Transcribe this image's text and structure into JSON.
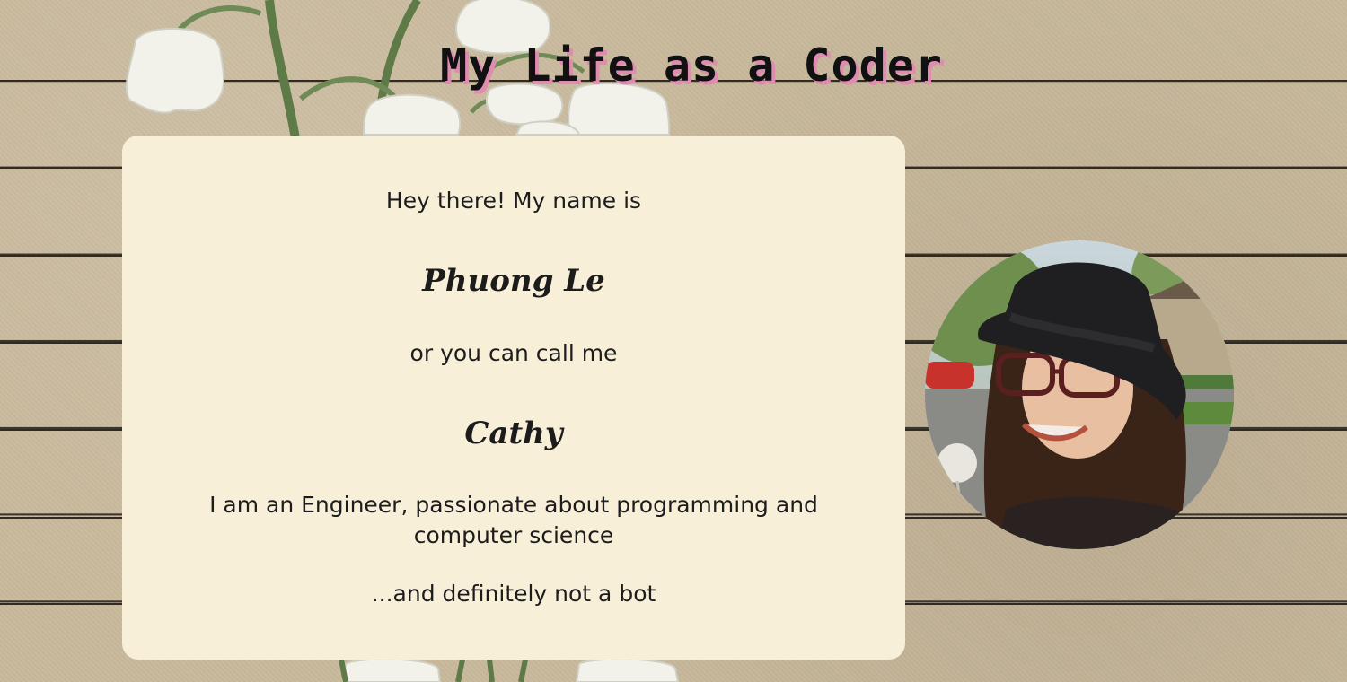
{
  "header": {
    "title": "My Life as a Coder"
  },
  "intro_card": {
    "greeting": "Hey there! My name is",
    "full_name": "Phuong Le",
    "nickname_intro": "or you can call me",
    "nickname": "Cathy",
    "description": "I am an Engineer, passionate about programming and computer science",
    "closing": "...and definitely not a bot"
  },
  "profile_photo": {
    "subject": "portrait-photo"
  },
  "colors": {
    "background_paper": "#c9b99c",
    "card_background": "#f8efd8",
    "title_shadow": "#e08bb0",
    "text": "#1c1c1c",
    "ruled_line": "#2f2a24"
  }
}
